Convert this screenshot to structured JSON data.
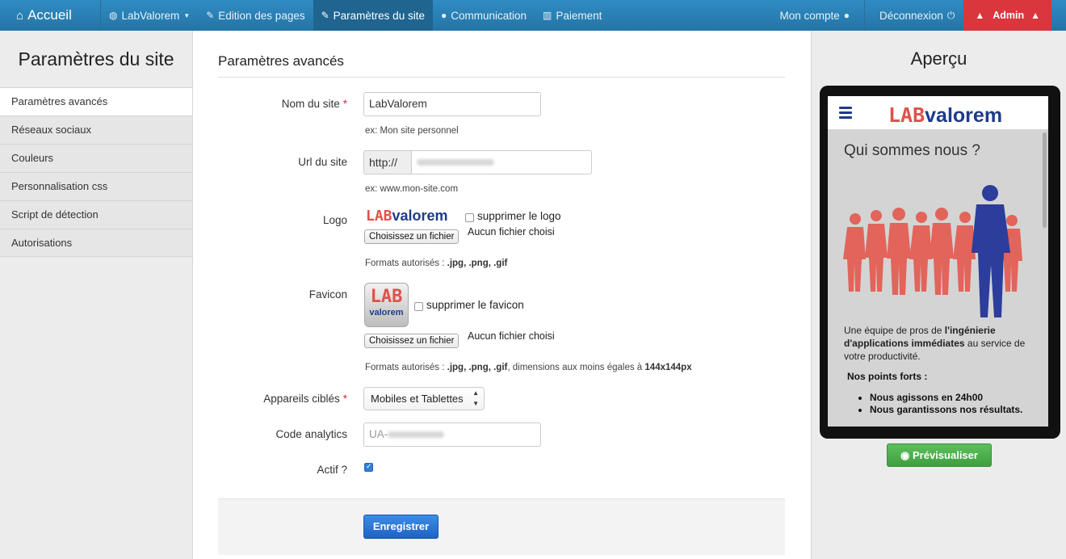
{
  "navbar": {
    "brand": "Accueil",
    "items": [
      {
        "label": "LabValorem",
        "icon": "globe-icon"
      },
      {
        "label": "Edition des pages",
        "icon": "edit-icon"
      },
      {
        "label": "Paramètres du site",
        "icon": "wrench-icon"
      },
      {
        "label": "Communication",
        "icon": "chat-icon"
      },
      {
        "label": "Paiement",
        "icon": "barcode-icon"
      }
    ],
    "account": "Mon compte",
    "logout": "Déconnexion",
    "admin": "Admin"
  },
  "sidebar": {
    "title": "Paramètres du site",
    "items": [
      {
        "label": "Paramètres avancés"
      },
      {
        "label": "Réseaux sociaux"
      },
      {
        "label": "Couleurs"
      },
      {
        "label": "Personnalisation css"
      },
      {
        "label": "Script de détection"
      },
      {
        "label": "Autorisations"
      }
    ]
  },
  "form": {
    "title": "Paramètres avancés",
    "site_name": {
      "label": "Nom du site",
      "value": "LabValorem",
      "help": "ex: Mon site personnel"
    },
    "site_url": {
      "label": "Url du site",
      "prefix": "http://",
      "help": "ex: www.mon-site.com"
    },
    "logo": {
      "label": "Logo",
      "logo_lab": "LAB",
      "logo_valorem": "valorem",
      "delete_label": "supprimer le logo",
      "file_button": "Choisissez un fichier",
      "file_status": "Aucun fichier choisi",
      "help_prefix": "Formats autorisés :",
      "help_formats": ".jpg, .png, .gif"
    },
    "favicon": {
      "label": "Favicon",
      "fav_lab": "LAB",
      "fav_valorem": "valorem",
      "delete_label": "supprimer le favicon",
      "file_button": "Choisissez un fichier",
      "file_status": "Aucun fichier choisi",
      "help_prefix": "Formats autorisés :",
      "help_formats": ".jpg, .png, .gif",
      "help_mid": ", dimensions aux moins égales à",
      "help_size": "144x144px"
    },
    "devices": {
      "label": "Appareils ciblés",
      "value": "Mobiles et Tablettes"
    },
    "analytics": {
      "label": "Code analytics",
      "value_prefix": "UA-"
    },
    "active": {
      "label": "Actif ?",
      "checked": true
    },
    "required_mark": "*",
    "save_button": "Enregistrer"
  },
  "preview": {
    "title": "Aperçu",
    "screen_logo_lab": "LAB",
    "screen_logo_valorem": "valorem",
    "screen_heading": "Qui sommes nous ?",
    "screen_text_1": "Une équipe de pros de ",
    "screen_text_bold": "l'ingénierie d'applications immédiates",
    "screen_text_2": " au service de votre productivité.",
    "screen_strengths": "Nos points forts :",
    "screen_points": [
      "Nous agissons en 24h00",
      "Nous garantissons nos résultats."
    ],
    "preview_button": "Prévisualiser"
  },
  "colors": {
    "navbar": "#2a7fb5",
    "admin": "#d9363e",
    "save": "#2a6fd4",
    "preview_button": "#4cae4c",
    "logo_red": "#e0524a",
    "logo_blue": "#1e3a8a"
  }
}
